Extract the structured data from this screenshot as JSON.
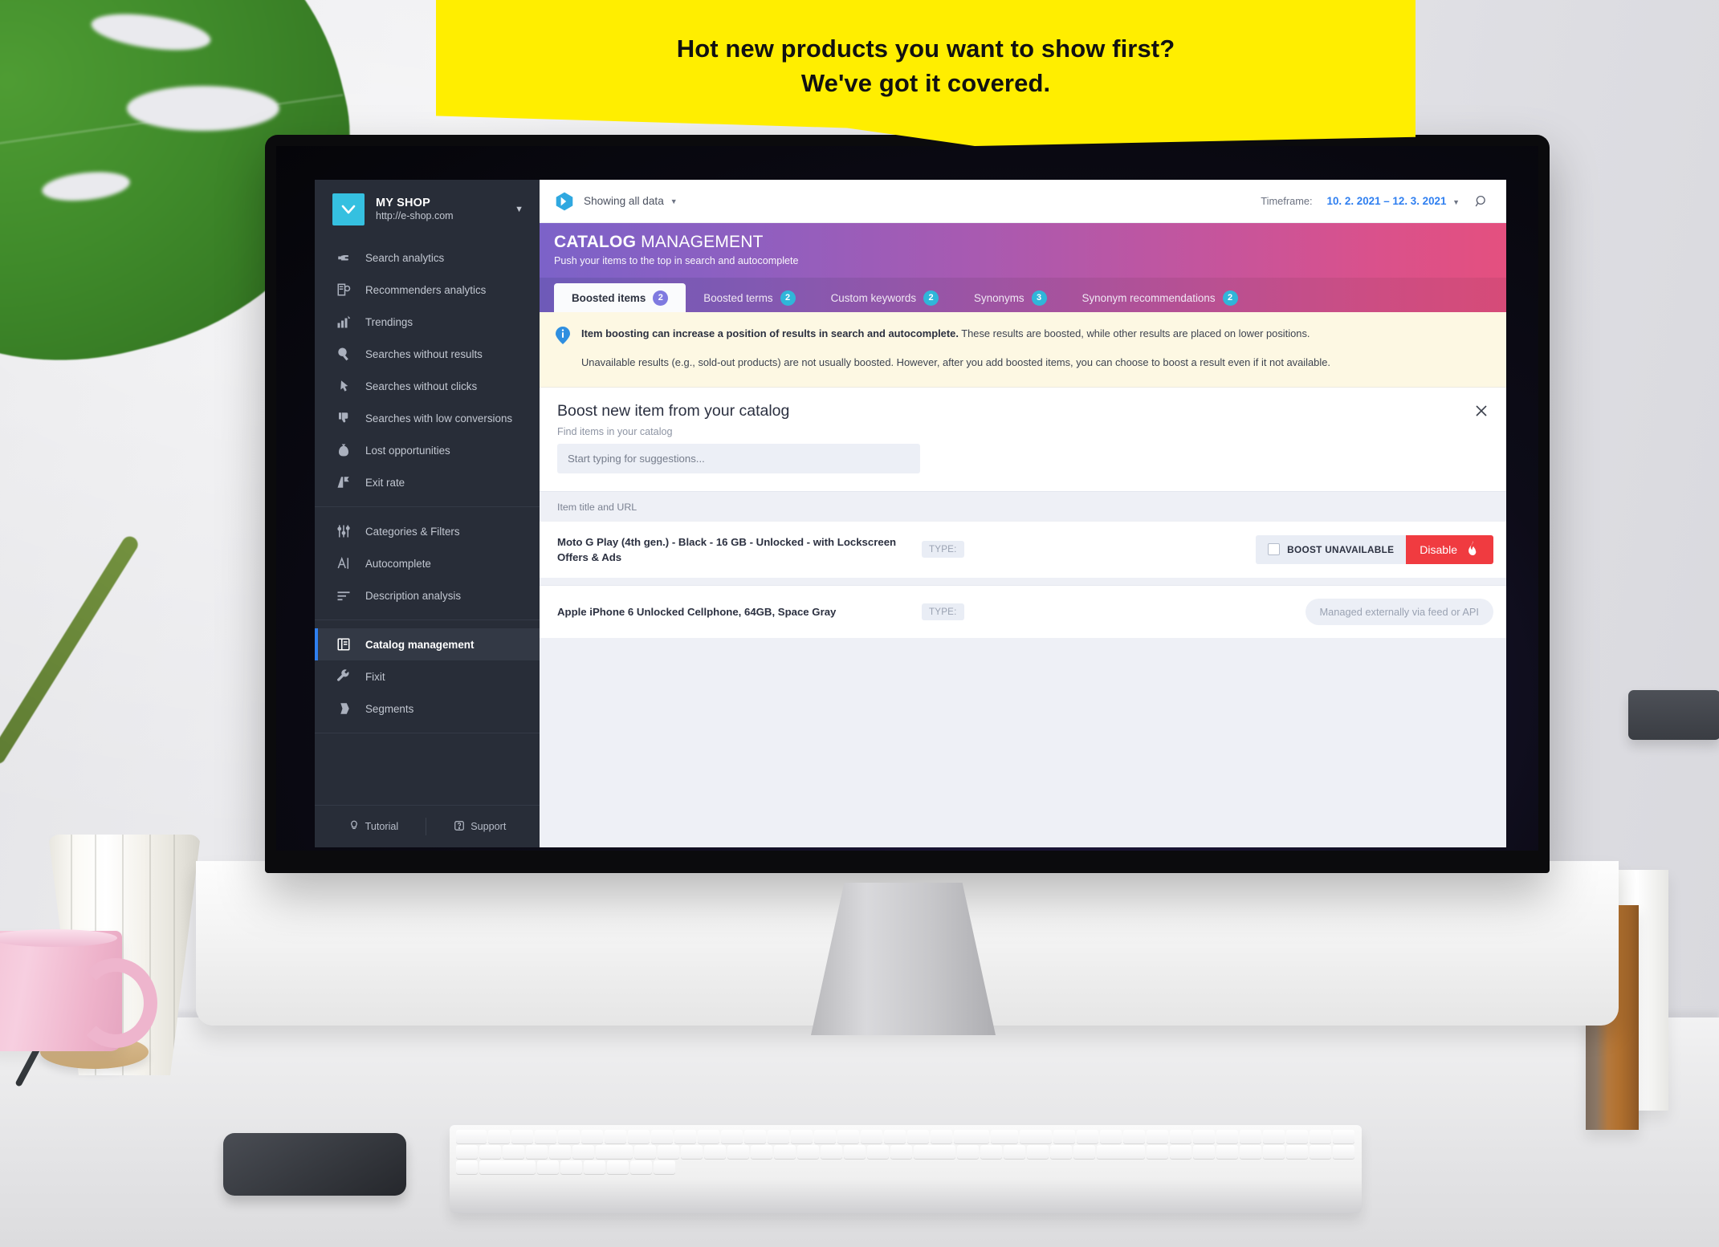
{
  "callout": {
    "line1": "Hot new products you want to show first?",
    "line2": "We've got it covered.",
    "bg_color": "#ffee00",
    "text_color": "#111111"
  },
  "sidebar": {
    "shop": {
      "name": "MY SHOP",
      "url": "http://e-shop.com",
      "logo_icon": "chevron-down-logo",
      "caret_icon": "chevron-down-icon",
      "logo_color": "#35c0e0"
    },
    "groups": [
      {
        "items": [
          {
            "label": "Search analytics",
            "icon": "hand-point-icon"
          },
          {
            "label": "Recommenders analytics",
            "icon": "document-bulb-icon"
          },
          {
            "label": "Trendings",
            "icon": "bar-chart-icon"
          },
          {
            "label": "Searches without results",
            "icon": "magnifier-icon"
          },
          {
            "label": "Searches without clicks",
            "icon": "cursor-click-icon"
          },
          {
            "label": "Searches with low conversions",
            "icon": "thumbs-down-icon"
          },
          {
            "label": "Lost opportunities",
            "icon": "money-bag-icon"
          },
          {
            "label": "Exit rate",
            "icon": "exit-arrow-icon"
          }
        ]
      },
      {
        "items": [
          {
            "label": "Categories & Filters",
            "icon": "sliders-icon"
          },
          {
            "label": "Autocomplete",
            "icon": "text-cursor-icon"
          },
          {
            "label": "Description analysis",
            "icon": "text-lines-icon"
          }
        ]
      },
      {
        "items": [
          {
            "label": "Catalog management",
            "icon": "book-icon",
            "active": true
          },
          {
            "label": "Fixit",
            "icon": "wrench-icon"
          },
          {
            "label": "Segments",
            "icon": "layers-icon"
          }
        ]
      }
    ],
    "footer": [
      {
        "label": "Tutorial",
        "icon": "bulb-icon"
      },
      {
        "label": "Support",
        "icon": "question-circle-icon"
      }
    ],
    "active_accent": "#2f7ff0"
  },
  "topbar": {
    "brand_icon": "luigis-box-icon",
    "showing_label": "Showing all data",
    "showing_caret_icon": "chevron-down-icon",
    "timeframe_label": "Timeframe:",
    "timeframe_value": "10. 2. 2021 – 12. 3. 2021",
    "timeframe_caret_icon": "chevron-down-icon",
    "search_icon": "search-icon",
    "accent_color": "#2f7ff0"
  },
  "hero": {
    "title_bold": "CATALOG",
    "title_rest": " MANAGEMENT",
    "subtitle": "Push your items to the top in search and autocomplete"
  },
  "tabs": [
    {
      "label": "Boosted items",
      "badge": "2",
      "active": true
    },
    {
      "label": "Boosted terms",
      "badge": "2",
      "active": false
    },
    {
      "label": "Custom keywords",
      "badge": "2",
      "active": false
    },
    {
      "label": "Synonyms",
      "badge": "3",
      "active": false
    },
    {
      "label": "Synonym recommendations",
      "badge": "2",
      "active": false
    }
  ],
  "notice": {
    "icon": "info-icon",
    "p1_bold": "Item boosting can increase a position of results in search and autocomplete.",
    "p1_rest": " These results are boosted, while other results are placed on lower positions.",
    "p2": "Unavailable results (e.g., sold-out products) are not usually boosted. However, after you add boosted items, you can choose to boost a result even if it not available."
  },
  "boost_panel": {
    "title": "Boost new item from your catalog",
    "subtitle": "Find items in your catalog",
    "input_placeholder": "Start typing for suggestions...",
    "input_value": "",
    "close_icon": "close-icon"
  },
  "list": {
    "column_header": "Item title and URL",
    "rows": [
      {
        "title": "Moto G Play (4th gen.) - Black - 16 GB - Unlocked - with Lockscreen Offers & Ads",
        "type_label": "TYPE:",
        "boost_unavailable_label": "BOOST UNAVAILABLE",
        "boost_unavailable_checked": false,
        "action_label": "Disable",
        "action_icon": "flame-icon",
        "action_color": "#f03b40"
      },
      {
        "title": "Apple iPhone 6 Unlocked Cellphone, 64GB, Space Gray",
        "type_label": "TYPE:",
        "managed_label": "Managed externally via feed or API"
      }
    ]
  }
}
